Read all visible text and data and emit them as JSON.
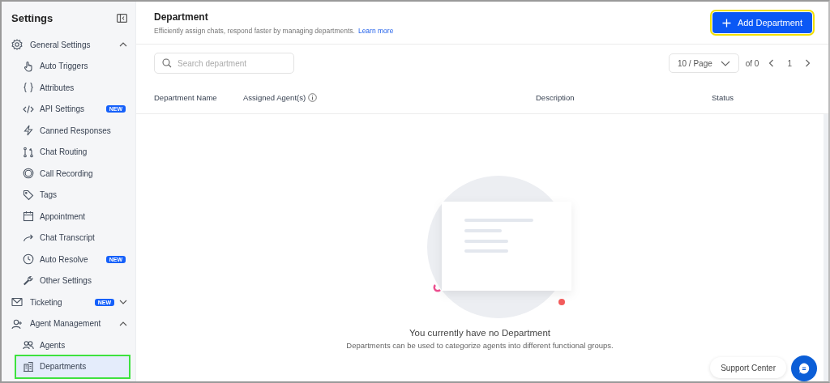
{
  "sidebar": {
    "title": "Settings",
    "groups": [
      {
        "label": "General Settings",
        "expanded": true,
        "children": [
          {
            "label": "Auto Triggers",
            "selected": false
          },
          {
            "label": "Attributes",
            "selected": false
          },
          {
            "label": "API Settings",
            "badge": "NEW",
            "selected": false
          },
          {
            "label": "Canned Responses",
            "selected": false
          },
          {
            "label": "Chat Routing",
            "selected": false
          },
          {
            "label": "Call Recording",
            "selected": false
          },
          {
            "label": "Tags",
            "selected": false
          },
          {
            "label": "Appointment",
            "selected": false
          },
          {
            "label": "Chat Transcript",
            "selected": false
          },
          {
            "label": "Auto Resolve",
            "badge": "NEW",
            "selected": false
          },
          {
            "label": "Other Settings",
            "selected": false
          }
        ]
      },
      {
        "label": "Ticketing",
        "badge": "NEW",
        "expanded": false
      },
      {
        "label": "Agent Management",
        "expanded": true,
        "children": [
          {
            "label": "Agents",
            "selected": false
          },
          {
            "label": "Departments",
            "selected": true
          }
        ]
      }
    ]
  },
  "header": {
    "title": "Department",
    "subtitle": "Efficiently assign chats, respond faster by managing departments.",
    "link": "Learn more",
    "button": {
      "label": "Add Department",
      "highlighted": true
    }
  },
  "search": {
    "placeholder": "Search department"
  },
  "pagination": {
    "page_size": "10 / Page",
    "total": "of 0",
    "page": "1"
  },
  "table": {
    "columns": [
      "Department Name",
      "Assigned Agent(s)",
      "Description",
      "Status"
    ]
  },
  "empty_state": {
    "title": "You currently have no Department",
    "text": "Departments can be used to categorize agents into different functional groups."
  },
  "support": {
    "label": "Support Center"
  }
}
